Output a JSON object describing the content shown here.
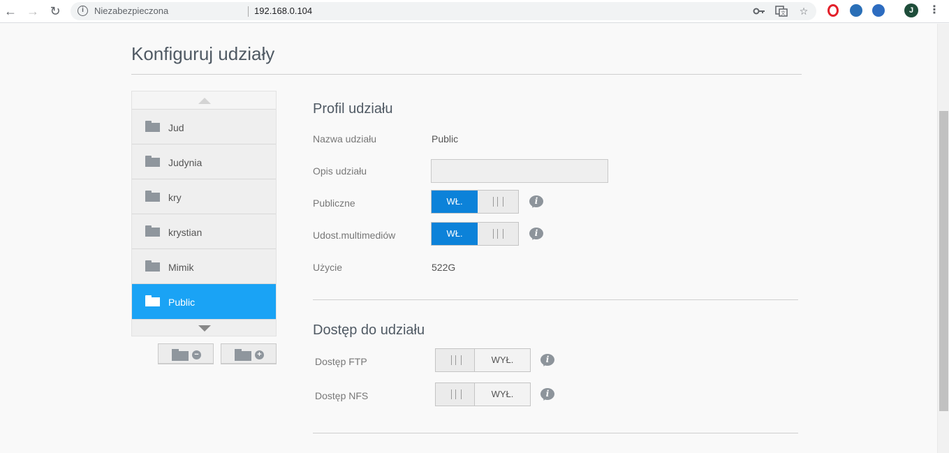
{
  "browser": {
    "security_label": "Niezabezpieczona",
    "url": "192.168.0.104",
    "avatar_letter": "J"
  },
  "page": {
    "title": "Konfiguruj udziały"
  },
  "shares": {
    "items": [
      {
        "label": "Jud",
        "active": false
      },
      {
        "label": "Judynia",
        "active": false
      },
      {
        "label": "kry",
        "active": false
      },
      {
        "label": "krystian",
        "active": false
      },
      {
        "label": "Mimik",
        "active": false
      },
      {
        "label": "Public",
        "active": true
      }
    ],
    "remove_badge": "−",
    "add_badge": "+"
  },
  "profile": {
    "title": "Profil udziału",
    "name_label": "Nazwa udziału",
    "name_value": "Public",
    "desc_label": "Opis udziału",
    "desc_value": "",
    "public_label": "Publiczne",
    "public_toggle": "WŁ.",
    "media_label": "Udost.multimediów",
    "media_toggle": "WŁ.",
    "usage_label": "Użycie",
    "usage_value": "522G"
  },
  "access": {
    "title": "Dostęp do udziału",
    "ftp_label": "Dostęp FTP",
    "ftp_toggle": "WYŁ.",
    "nfs_label": "Dostęp NFS",
    "nfs_toggle": "WYŁ."
  },
  "info_glyph": "i",
  "colors": {
    "accent": "#1aa3f5",
    "toggle_on": "#0c82d9",
    "icon_grey": "#8f969d"
  }
}
